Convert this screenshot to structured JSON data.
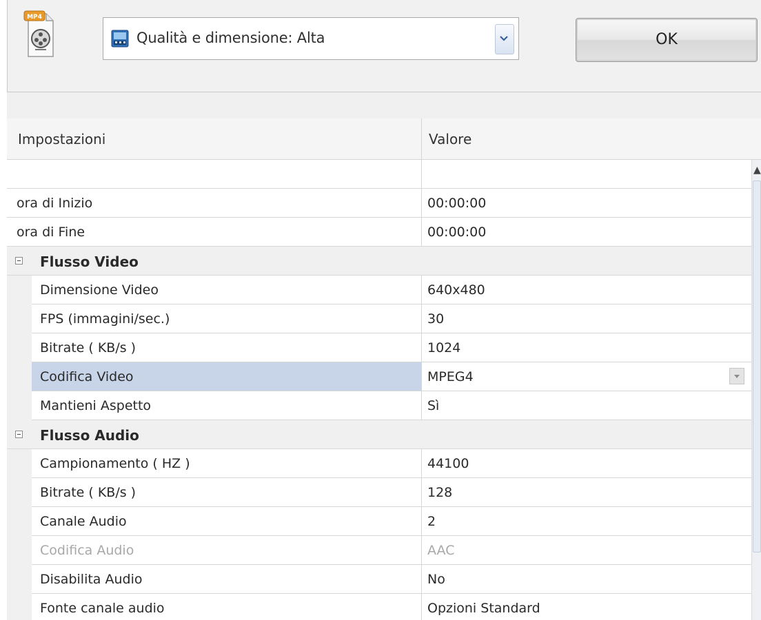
{
  "toolbar": {
    "app_icon": "mp4-file-icon",
    "app_icon_label": "MP4",
    "quality_select": {
      "icon": "film-icon",
      "value": "Qualità e dimensione: Alta"
    },
    "ok_label": "OK"
  },
  "grid": {
    "columns": [
      "Impostazioni",
      "Valore"
    ],
    "rows": [
      {
        "name": "",
        "value": ""
      },
      {
        "name": "ora di Inizio",
        "value": "00:00:00"
      },
      {
        "name": "ora di Fine",
        "value": "00:00:00"
      },
      {
        "name": "Flusso Video",
        "value": ""
      },
      {
        "name": "Dimensione Video",
        "value": "640x480"
      },
      {
        "name": "FPS (immagini/sec.)",
        "value": "30"
      },
      {
        "name": "Bitrate ( KB/s )",
        "value": "1024"
      },
      {
        "name": "Codifica Video",
        "value": "MPEG4"
      },
      {
        "name": "Mantieni Aspetto",
        "value": "Sì"
      },
      {
        "name": "Flusso Audio",
        "value": ""
      },
      {
        "name": "Campionamento ( HZ )",
        "value": "44100"
      },
      {
        "name": "Bitrate ( KB/s )",
        "value": "128"
      },
      {
        "name": "Canale Audio",
        "value": "2"
      },
      {
        "name": "Codifica Audio",
        "value": "AAC"
      },
      {
        "name": "Disabilita Audio",
        "value": "No"
      },
      {
        "name": "Fonte canale audio",
        "value": "Opzioni Standard"
      }
    ]
  },
  "colors": {
    "selection": "#c8d4e8",
    "group_bg": "#f0f0f0",
    "disabled_text": "#a8a8a8"
  }
}
